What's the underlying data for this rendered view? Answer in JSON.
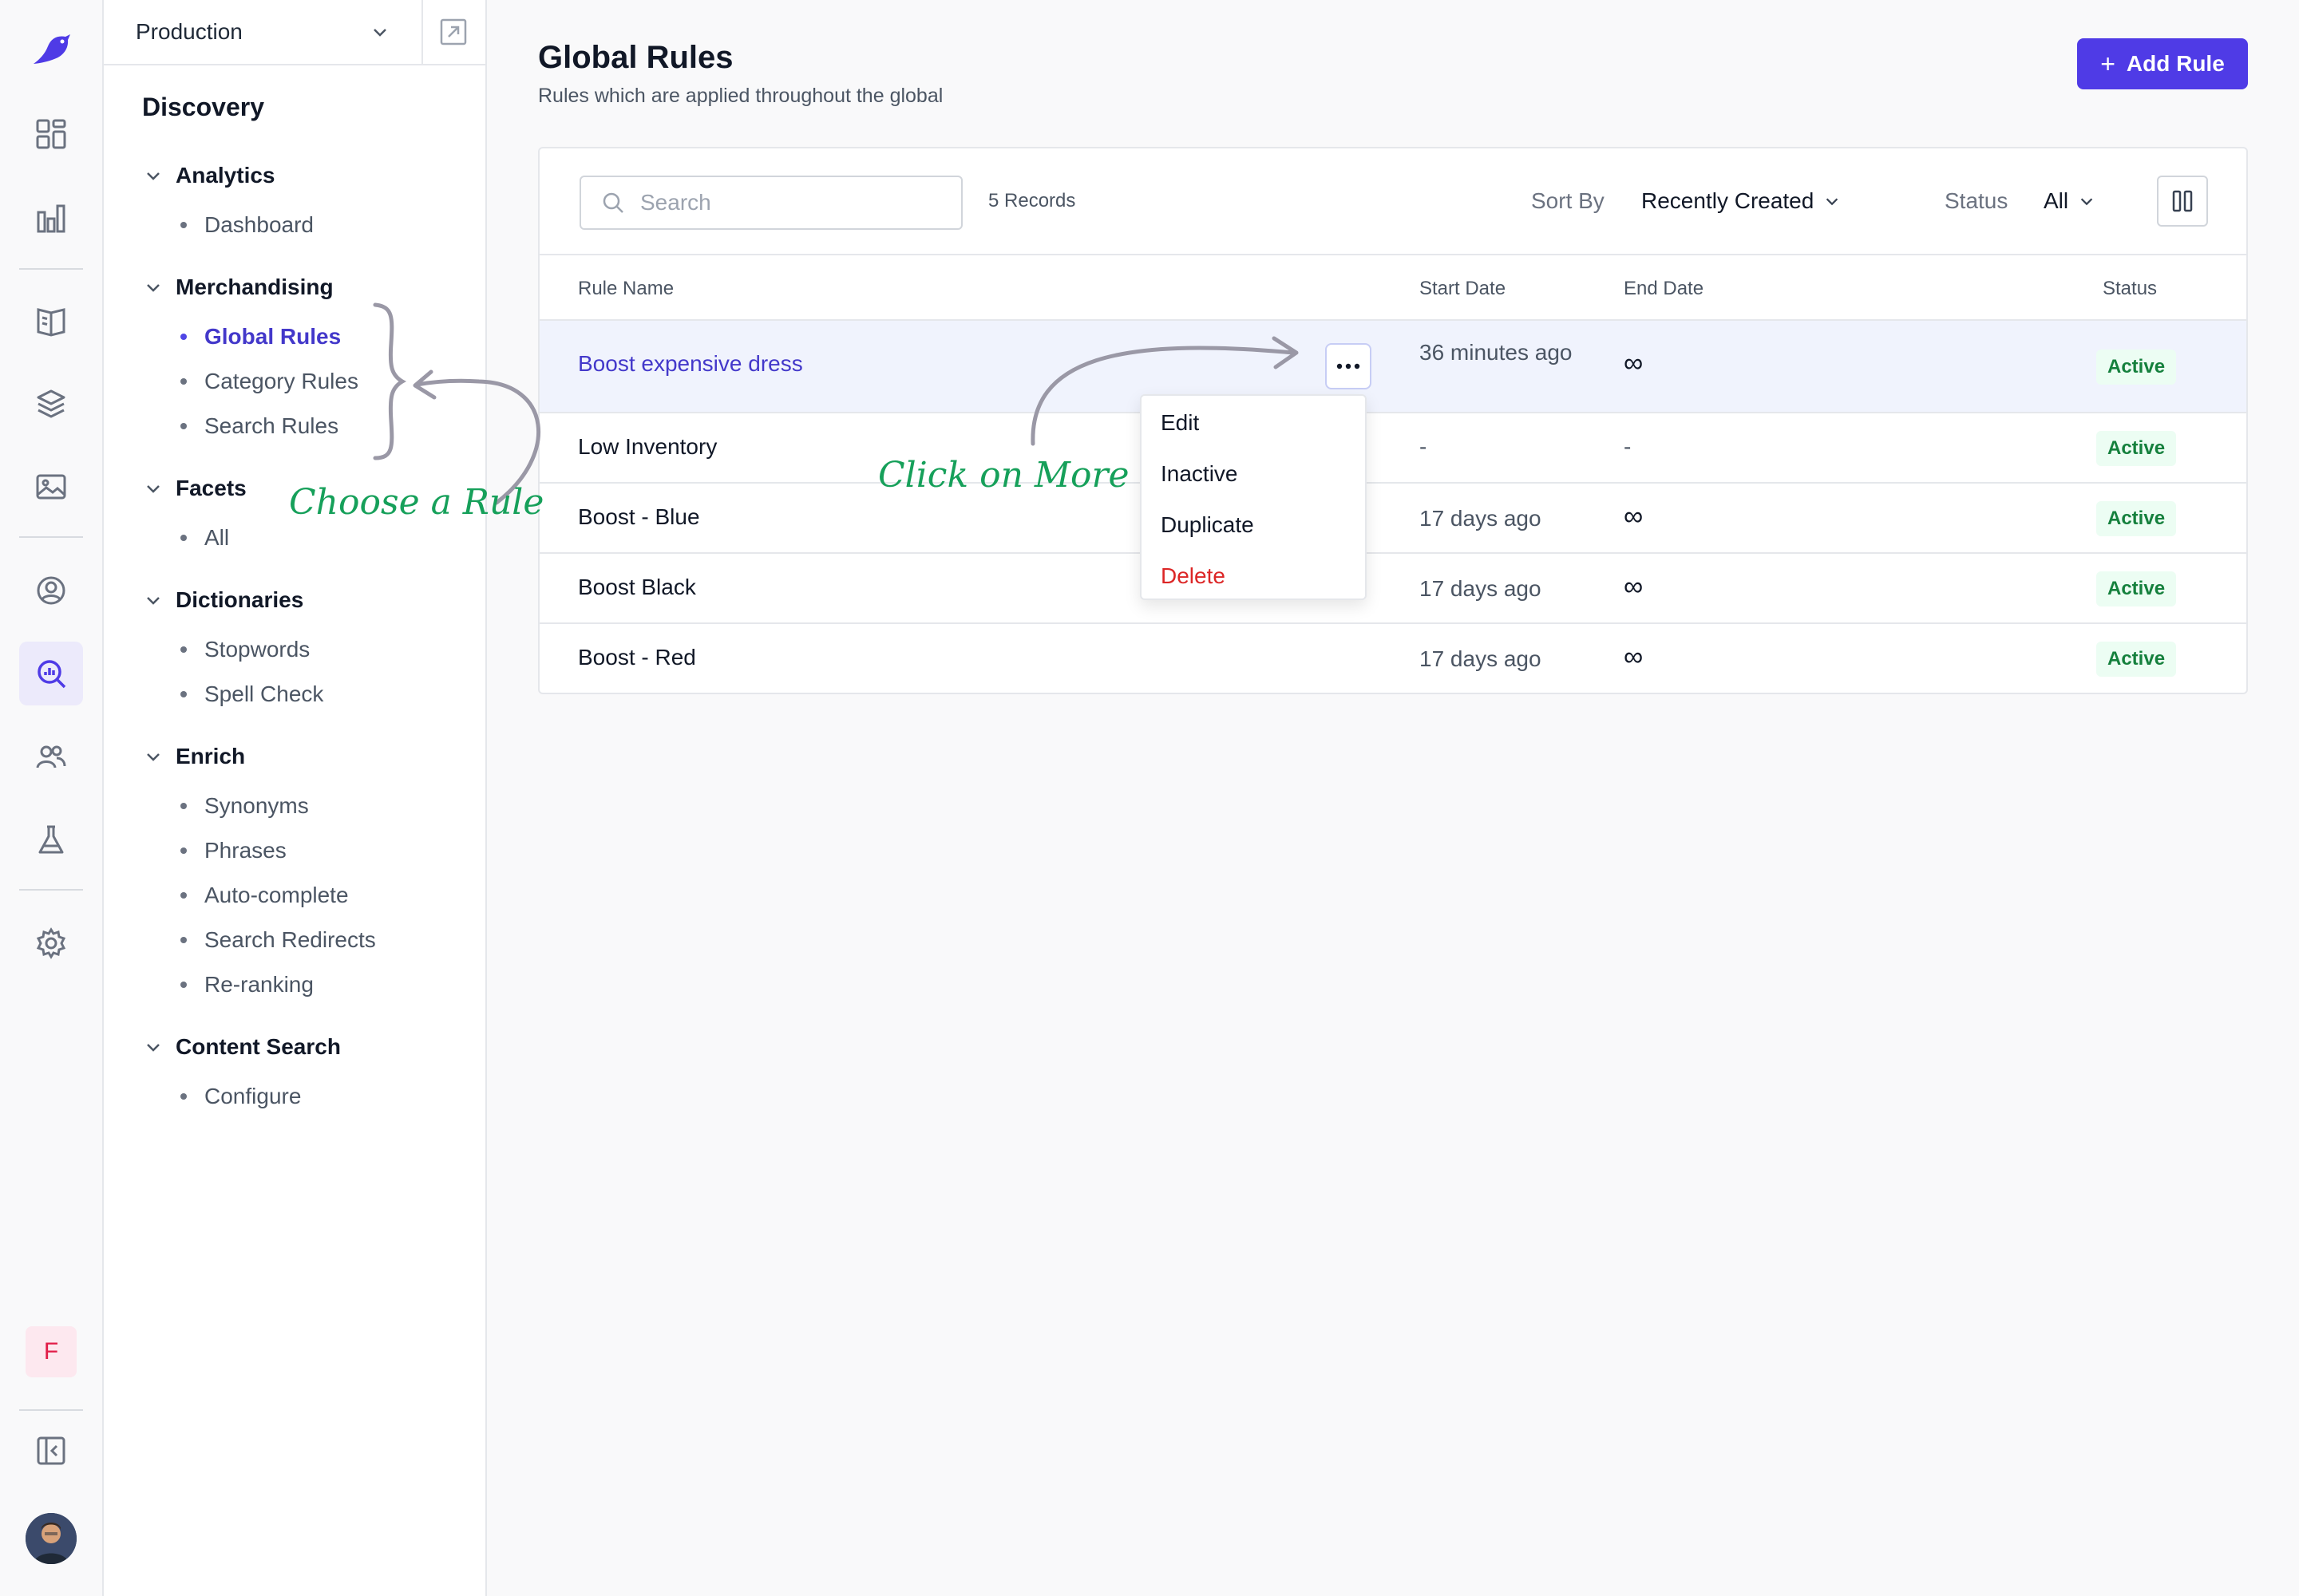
{
  "environment": {
    "selected": "Production"
  },
  "nav": {
    "title": "Discovery",
    "groups": [
      {
        "label": "Analytics",
        "items": [
          "Dashboard"
        ]
      },
      {
        "label": "Merchandising",
        "items": [
          "Global Rules",
          "Category Rules",
          "Search Rules"
        ]
      },
      {
        "label": "Facets",
        "items": [
          "All"
        ]
      },
      {
        "label": "Dictionaries",
        "items": [
          "Stopwords",
          "Spell Check"
        ]
      },
      {
        "label": "Enrich",
        "items": [
          "Synonyms",
          "Phrases",
          "Auto-complete",
          "Search Redirects",
          "Re-ranking"
        ]
      },
      {
        "label": "Content Search",
        "items": [
          "Configure"
        ]
      }
    ]
  },
  "workspace": {
    "initial": "F"
  },
  "page": {
    "title": "Global Rules",
    "subtitle": "Rules which are applied throughout the global",
    "add_button": "Add Rule"
  },
  "toolbar": {
    "search_placeholder": "Search",
    "records": "5 Records",
    "sort_label": "Sort By",
    "sort_value": "Recently Created",
    "status_label": "Status",
    "status_value": "All"
  },
  "table": {
    "columns": [
      "Rule Name",
      "Start Date",
      "End Date",
      "Status"
    ],
    "rows": [
      {
        "name": "Boost expensive dress",
        "start": "36 minutes ago",
        "end": "∞",
        "status": "Active"
      },
      {
        "name": "Low Inventory",
        "start": "-",
        "end": "-",
        "status": "Active"
      },
      {
        "name": "Boost - Blue",
        "start": "17 days ago",
        "end": "∞",
        "status": "Active"
      },
      {
        "name": "Boost Black",
        "start": "17 days ago",
        "end": "∞",
        "status": "Active"
      },
      {
        "name": "Boost - Red",
        "start": "17 days ago",
        "end": "∞",
        "status": "Active"
      }
    ]
  },
  "row_menu": {
    "items": [
      "Edit",
      "Inactive",
      "Duplicate",
      "Delete"
    ]
  },
  "annotations": {
    "choose_rule": "Choose a Rule",
    "click_more": "Click on More"
  },
  "colors": {
    "accent": "#4f3be6",
    "link": "#4338ca",
    "active_badge": "#15803d",
    "annotation": "#16a05a",
    "danger": "#dc2626"
  }
}
